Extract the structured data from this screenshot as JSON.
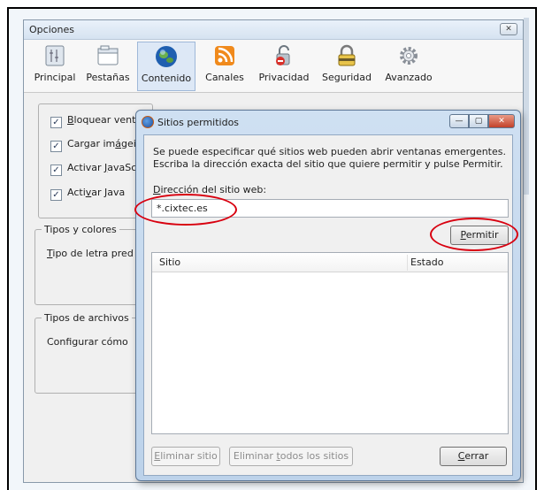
{
  "options_window": {
    "title": "Opciones",
    "close_glyph": "✕",
    "toolbar": [
      {
        "label": "Principal",
        "icon": "principal-icon"
      },
      {
        "label": "Pestañas",
        "icon": "tabs-icon"
      },
      {
        "label": "Contenido",
        "icon": "globe-icon",
        "selected": true
      },
      {
        "label": "Canales",
        "icon": "feed-icon"
      },
      {
        "label": "Privacidad",
        "icon": "privacy-icon"
      },
      {
        "label": "Seguridad",
        "icon": "padlock-icon"
      },
      {
        "label": "Avanzado",
        "icon": "gear-icon"
      }
    ],
    "checkboxes": [
      {
        "prefix": "",
        "accel": "B",
        "suffix": "loquear vent",
        "checked": true
      },
      {
        "prefix": "Cargar im",
        "accel": "á",
        "suffix": "gei",
        "checked": true
      },
      {
        "prefix": "Activar ",
        "accel": "J",
        "suffix": "avaSc",
        "checked": true
      },
      {
        "prefix": "Acti",
        "accel": "v",
        "suffix": "ar Java",
        "checked": true
      }
    ],
    "fonts_group_legend": "Tipos y colores",
    "font_label_accel": "T",
    "font_label_rest": "ipo de letra pred",
    "files_group_legend": "Tipos de archivos",
    "files_configure_text": "Configurar cómo"
  },
  "dialog": {
    "title": "Sitios permitidos",
    "description_line1": "Se puede especificar qué sitios web pueden abrir ventanas emergentes.",
    "description_line2": "Escriba la dirección exacta del sitio que quiere permitir y pulse Permitir.",
    "address_label_accel": "D",
    "address_label_rest": "irección del sitio web:",
    "address_value": "*.cixtec.es",
    "allow_button_accel": "P",
    "allow_button_rest": "ermitir",
    "columns": [
      "Sitio",
      "Estado"
    ],
    "remove_site_accel": "E",
    "remove_site_rest": "liminar sitio",
    "remove_all_prefix": "Eliminar ",
    "remove_all_accel": "t",
    "remove_all_rest": "odos los sitios",
    "close_button_accel": "C",
    "close_button_rest": "errar",
    "window_buttons": {
      "minimize": "—",
      "maximize": "▢",
      "close": "✕"
    }
  },
  "colors": {
    "highlight_ring": "#d8000f",
    "selected_tab_bg": "#dde8f6",
    "close_btn_red": "#c2412a"
  }
}
